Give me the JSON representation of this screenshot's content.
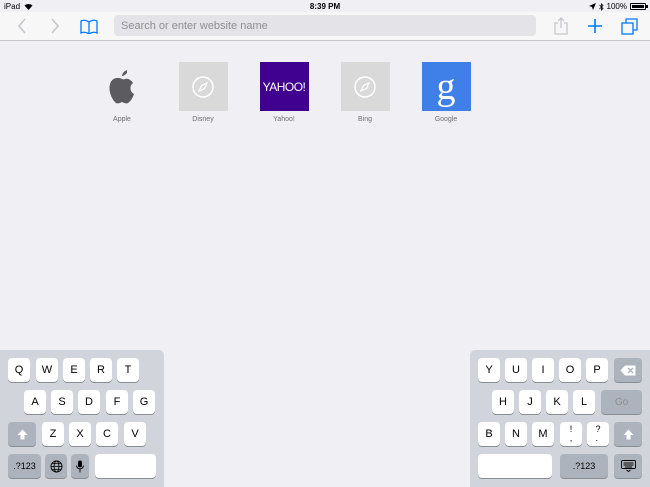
{
  "status_bar": {
    "device": "iPad",
    "time": "8:39 PM",
    "battery": "100%"
  },
  "toolbar": {
    "url_placeholder": "Search or enter website name",
    "back_icon": "chevron-left-icon",
    "forward_icon": "chevron-right-icon",
    "bookmarks_icon": "book-icon",
    "share_icon": "share-icon",
    "add_icon": "plus-icon",
    "tabs_icon": "tabs-icon"
  },
  "favorites": [
    {
      "label": "Apple",
      "icon": "apple-logo-icon"
    },
    {
      "label": "Disney",
      "icon": "compass-icon"
    },
    {
      "label": "Yahoo!",
      "tile_text": "YAHOO!"
    },
    {
      "label": "Bing",
      "icon": "compass-icon"
    },
    {
      "label": "Google",
      "tile_text": "g"
    }
  ],
  "keyboard": {
    "left": {
      "row1": [
        "Q",
        "W",
        "E",
        "R",
        "T"
      ],
      "row2": [
        "A",
        "S",
        "D",
        "F",
        "G"
      ],
      "row3": [
        "Z",
        "X",
        "C",
        "V"
      ],
      "numbers": ".?123"
    },
    "right": {
      "row1": [
        "Y",
        "U",
        "I",
        "O",
        "P"
      ],
      "row2": [
        "H",
        "J",
        "K",
        "L"
      ],
      "go": "Go",
      "row3": [
        "B",
        "N",
        "M",
        "!\n,",
        "?\n."
      ],
      "numbers": ".?123"
    }
  },
  "colors": {
    "accent": "#007aff",
    "yahoo": "#400090",
    "google": "#3f7fe8"
  }
}
